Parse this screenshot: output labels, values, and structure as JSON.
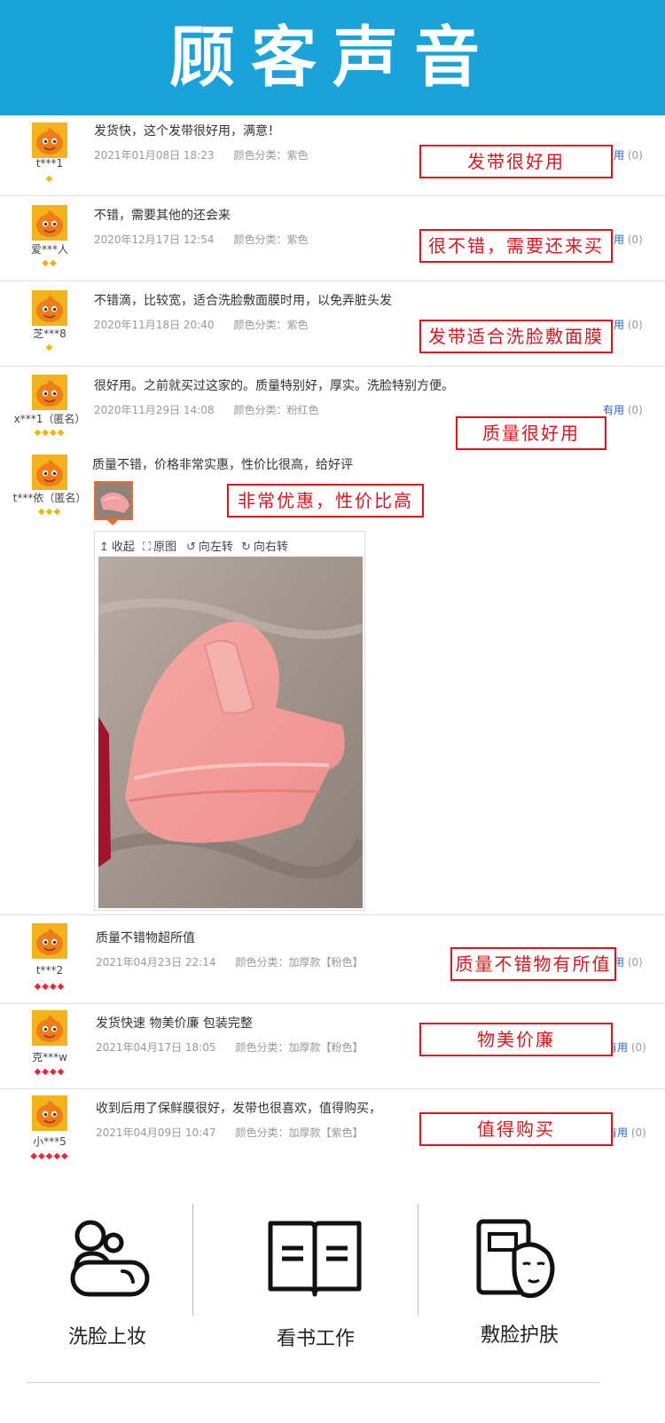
{
  "banner": {
    "title": "顾客声音"
  },
  "useful_label": "有用",
  "useful_count": "(0)",
  "reviews": [
    {
      "user": "t***1",
      "text": "发货快，这个发带很好用，满意！",
      "date": "2021年01月08日 18:23",
      "sku": "颜色分类：紫色",
      "callout": "发带很好用"
    },
    {
      "user": "爱***人",
      "text": "不错，需要其他的还会来",
      "date": "2020年12月17日 12:54",
      "sku": "颜色分类：紫色",
      "callout": "很不错，需要还来买"
    },
    {
      "user": "芝***8",
      "text": "不错滴，比较宽，适合洗脸敷面膜时用，以免弄脏头发",
      "date": "2020年11月18日 20:40",
      "sku": "颜色分类：紫色",
      "callout": "发带适合洗脸敷面膜"
    },
    {
      "user": "x***1（匿名）",
      "text": "很好用。之前就买过这家的。质量特别好，厚实。洗脸特别方便。",
      "date": "2020年11月29日 14:08",
      "sku": "颜色分类：粉红色",
      "callout": "质量很好用"
    },
    {
      "user": "t***依（匿名）",
      "text": "质量不错，价格非常实惠，性价比很高，给好评",
      "callout": "非常优惠，性价比高"
    },
    {
      "user": "t***2",
      "text": "质量不错物超所值",
      "date": "2021年04月23日 22:14",
      "sku": "颜色分类：加厚款【粉色】",
      "callout": "质量不错物有所值"
    },
    {
      "user": "克***w",
      "text": "发货快速 物美价廉 包装完整",
      "date": "2021年04月17日 18:05",
      "sku": "颜色分类：加厚款【粉色】",
      "callout": "物美价廉"
    },
    {
      "user": "小***5",
      "text": "收到后用了保鲜膜很好，发带也很喜欢，值得购买，",
      "date": "2021年04月09日 10:47",
      "sku": "颜色分类：加厚款【紫色】",
      "callout": "值得购买"
    }
  ],
  "viewer": {
    "collapse": "收起",
    "original": "原图",
    "rotate_left": "向左转",
    "rotate_right": "向右转"
  },
  "features": [
    {
      "label": "洗脸上妆",
      "icon": "face-wash-icon"
    },
    {
      "label": "看书工作",
      "icon": "open-book-icon"
    },
    {
      "label": "敷脸护肤",
      "icon": "face-mask-icon"
    }
  ],
  "colors": {
    "banner": "#1aa3d8",
    "callout": "#e0121b",
    "link": "#2a63c8"
  }
}
